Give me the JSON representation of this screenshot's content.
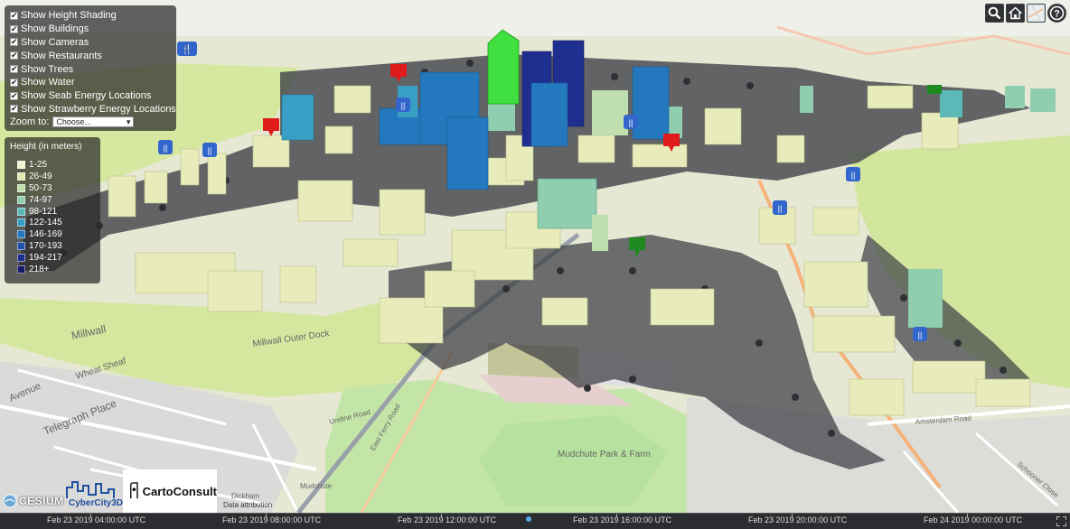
{
  "layers": {
    "items": [
      {
        "label": "Show Height Shading"
      },
      {
        "label": "Show Buildings"
      },
      {
        "label": "Show Cameras"
      },
      {
        "label": "Show Restaurants"
      },
      {
        "label": "Show Trees"
      },
      {
        "label": "Show Water"
      },
      {
        "label": "Show Seab Energy Locations"
      },
      {
        "label": "Show Strawberry Energy Locations"
      }
    ],
    "zoom_label": "Zoom to:",
    "zoom_value": "Choose..."
  },
  "legend": {
    "title": "Height (in meters)",
    "items": [
      {
        "label": "1-25",
        "color": "#f2f5cf"
      },
      {
        "label": "26-49",
        "color": "#dfe9b0"
      },
      {
        "label": "50-73",
        "color": "#bfe0ae"
      },
      {
        "label": "74-97",
        "color": "#8fcfb0"
      },
      {
        "label": "98-121",
        "color": "#5db8b8"
      },
      {
        "label": "122-145",
        "color": "#3a9fc4"
      },
      {
        "label": "146-169",
        "color": "#2478bd"
      },
      {
        "label": "170-193",
        "color": "#2050a8"
      },
      {
        "label": "194-217",
        "color": "#1f2f8f"
      },
      {
        "label": "218+",
        "color": "#141c66"
      }
    ]
  },
  "toolbar": {
    "search_icon": "search-icon",
    "home_icon": "home-icon",
    "base_layer_icon": "base-layer-icon",
    "help_icon": "help-icon"
  },
  "map_labels": {
    "millwall": "Millwall",
    "outer_dock": "Millwall Outer Dock",
    "telegraph": "Telegraph Place",
    "wheat": "Wheat Sheaf",
    "avenue": "Avenue",
    "undine": "Undine Road",
    "ferry": "East Ferry Road",
    "mudchute": "Mudchute Park & Farm",
    "amsterdam": "Amsterdam Road",
    "schooner": "Schooner Close",
    "dickham": "Dickham",
    "mudchute_station": "Mudchute"
  },
  "logos": {
    "cesium": "CESIUM",
    "cybercity": "CyberCity3D",
    "carto": "CartoConsult",
    "data_attribution": "Data attribution"
  },
  "timeline": {
    "ticks": [
      "Feb 23 2019 04:00:00 UTC",
      "Feb 23 2019 08:00:00 UTC",
      "Feb 23 2019 12:00:00 UTC",
      "Feb 23 2019 16:00:00 UTC",
      "Feb 23 2019 20:00:00 UTC",
      "Feb 24 2019 00:00:00 UTC"
    ]
  },
  "colors": {
    "park": "#c9e6a3",
    "land": "#eceedc",
    "restaurant_marker": "#3366cc",
    "camera_marker": "#e01b1b",
    "energy_marker": "#1f8a1f"
  }
}
